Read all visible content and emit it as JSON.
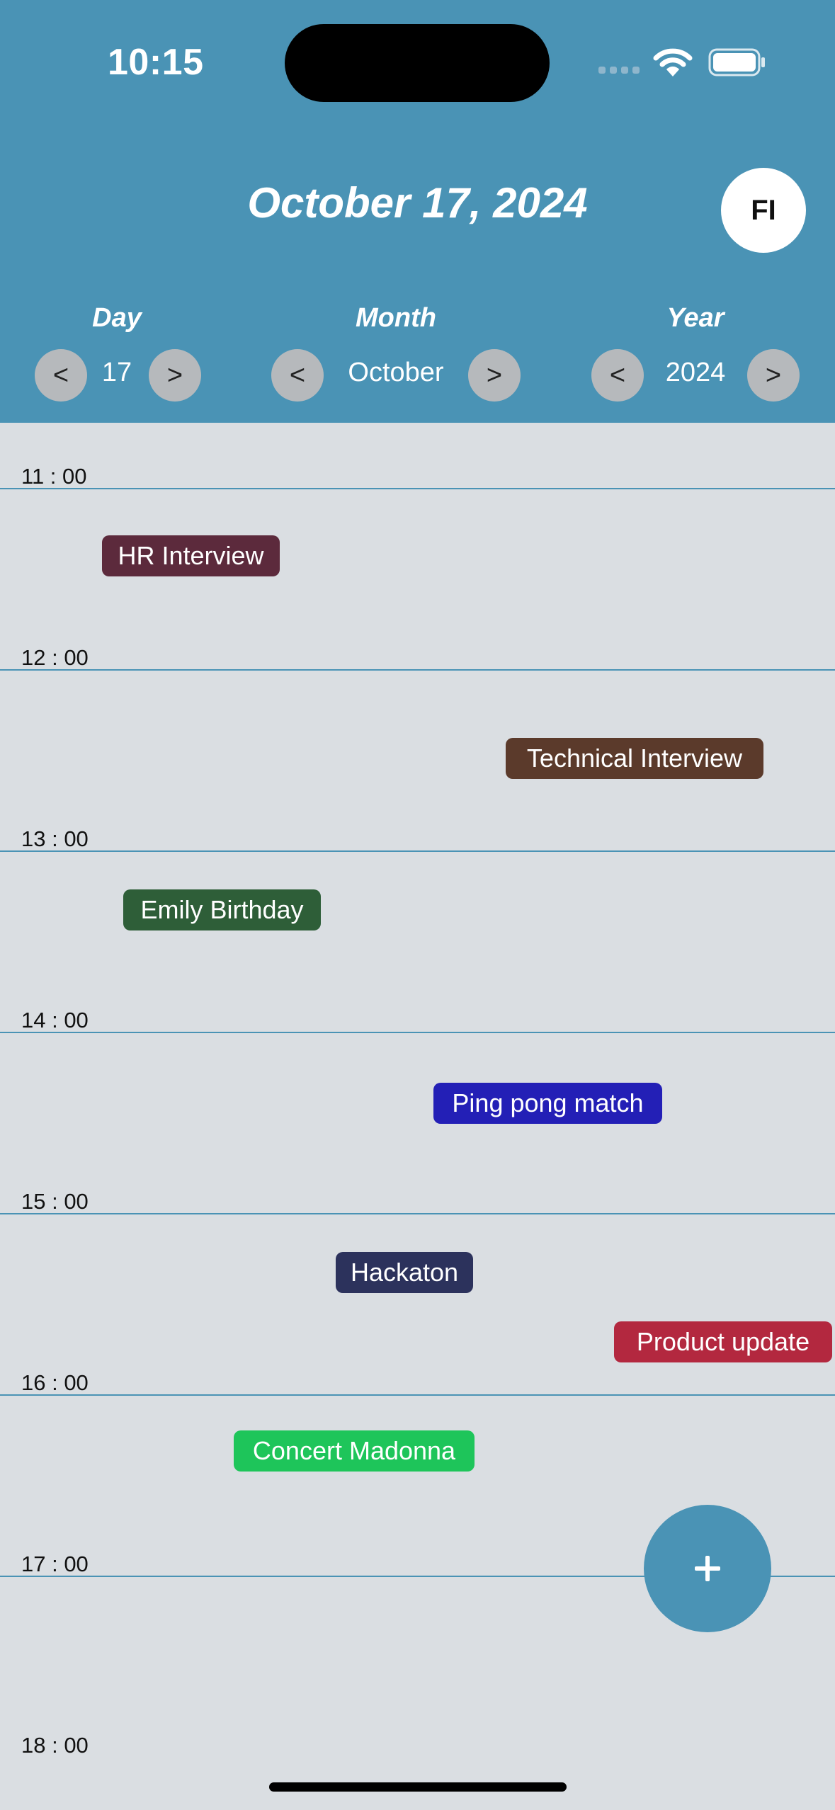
{
  "status_bar": {
    "time": "10:15",
    "icons": [
      "cellular-signal-icon",
      "wifi-icon",
      "battery-icon"
    ]
  },
  "header": {
    "date_title": "October 17, 2024",
    "avatar_initials": "FI",
    "background_color": "#4a93b5"
  },
  "selectors": {
    "day": {
      "label": "Day",
      "value": "17",
      "prev": "<",
      "next": ">"
    },
    "month": {
      "label": "Month",
      "value": "October",
      "prev": "<",
      "next": ">"
    },
    "year": {
      "label": "Year",
      "value": "2024",
      "prev": "<",
      "next": ">"
    }
  },
  "timeline": {
    "hours": [
      "11 : 00",
      "12 : 00",
      "13 : 00",
      "14 : 00",
      "15 : 00",
      "16 : 00",
      "17 : 00",
      "18 : 00"
    ],
    "events": [
      {
        "title": "HR Interview",
        "color": "#5c2a3c"
      },
      {
        "title": "Technical Interview",
        "color": "#5b3a2b"
      },
      {
        "title": "Emily Birthday",
        "color": "#2e5e38"
      },
      {
        "title": "Ping pong match",
        "color": "#231fb6"
      },
      {
        "title": "Hackaton",
        "color": "#2c325c"
      },
      {
        "title": "Product update",
        "color": "#b3283f"
      },
      {
        "title": "Concert Madonna",
        "color": "#1ec55a"
      }
    ]
  },
  "fab": {
    "label": "+",
    "icon": "plus-icon"
  }
}
